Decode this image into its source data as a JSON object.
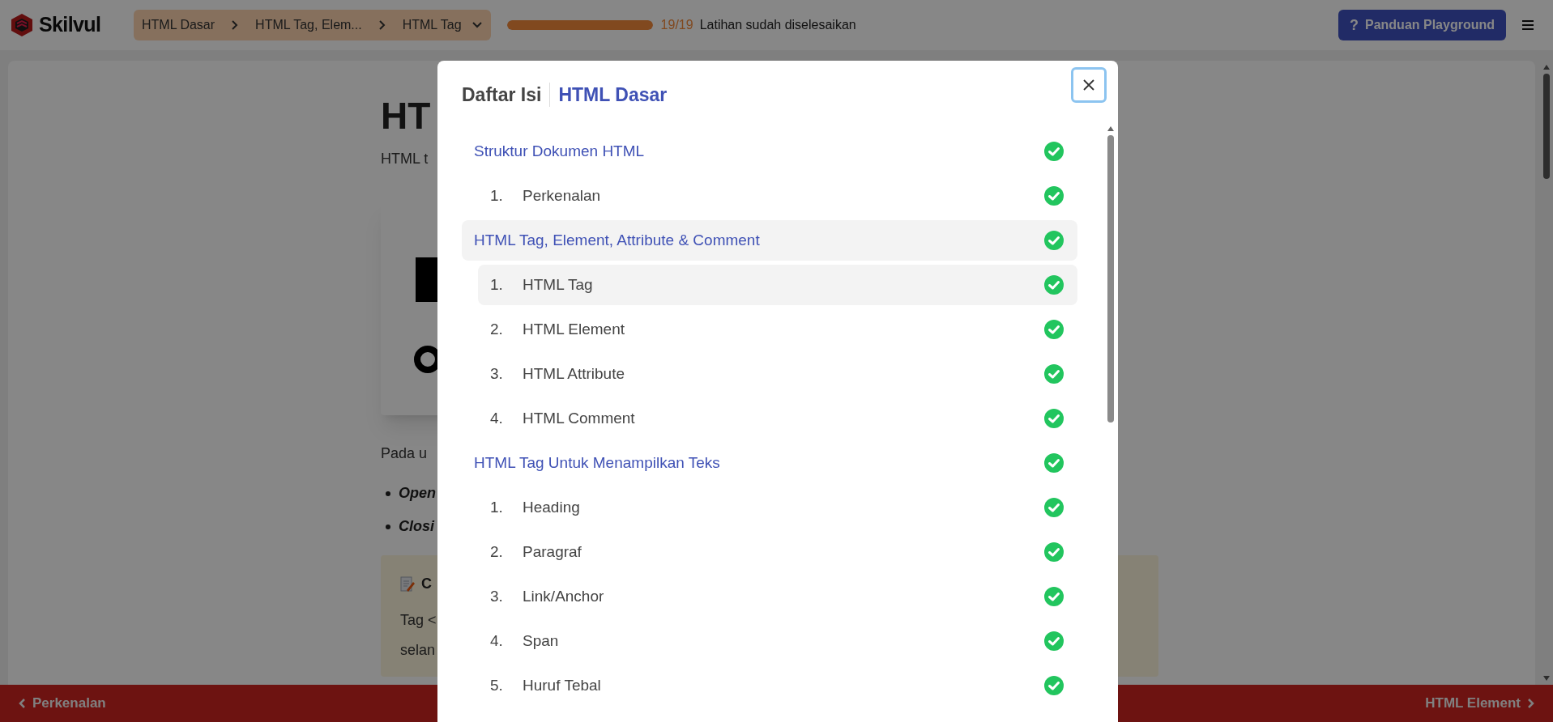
{
  "header": {
    "logo": "Skilvul",
    "breadcrumb": [
      "HTML Dasar",
      "HTML Tag, Elem...",
      "HTML Tag"
    ],
    "progress": {
      "level": 1,
      "count": "19/19",
      "label": "Latihan sudah diselesaikan"
    },
    "guide_button": {
      "glyph": "?",
      "label": "Panduan Playground"
    }
  },
  "lesson": {
    "heading": "HT",
    "intro": "HTML t",
    "after_image": "Pada u",
    "bullets": [
      "Open",
      "Closi"
    ],
    "note": {
      "title": "C",
      "lines": [
        "Tag <",
        "selan"
      ]
    }
  },
  "footer": {
    "previous": "Perkenalan",
    "next": "HTML Element"
  },
  "modal": {
    "title": "Daftar Isi",
    "subtitle": "HTML Dasar",
    "sections": [
      {
        "title": "Struktur Dokumen HTML",
        "selected": false,
        "done": true,
        "children": [
          {
            "number": "1.",
            "title": "Perkenalan",
            "selected": false,
            "done": true
          }
        ]
      },
      {
        "title": "HTML Tag, Element, Attribute & Comment",
        "selected": true,
        "done": true,
        "children": [
          {
            "number": "1.",
            "title": "HTML Tag",
            "selected": true,
            "done": true
          },
          {
            "number": "2.",
            "title": "HTML Element",
            "selected": false,
            "done": true
          },
          {
            "number": "3.",
            "title": "HTML Attribute",
            "selected": false,
            "done": true
          },
          {
            "number": "4.",
            "title": "HTML Comment",
            "selected": false,
            "done": true
          }
        ]
      },
      {
        "title": "HTML Tag Untuk Menampilkan Teks",
        "selected": false,
        "done": true,
        "children": [
          {
            "number": "1.",
            "title": "Heading",
            "selected": false,
            "done": true
          },
          {
            "number": "2.",
            "title": "Paragraf",
            "selected": false,
            "done": true
          },
          {
            "number": "3.",
            "title": "Link/Anchor",
            "selected": false,
            "done": true
          },
          {
            "number": "4.",
            "title": "Span",
            "selected": false,
            "done": true
          },
          {
            "number": "5.",
            "title": "Huruf Tebal",
            "selected": false,
            "done": true
          }
        ]
      }
    ]
  }
}
